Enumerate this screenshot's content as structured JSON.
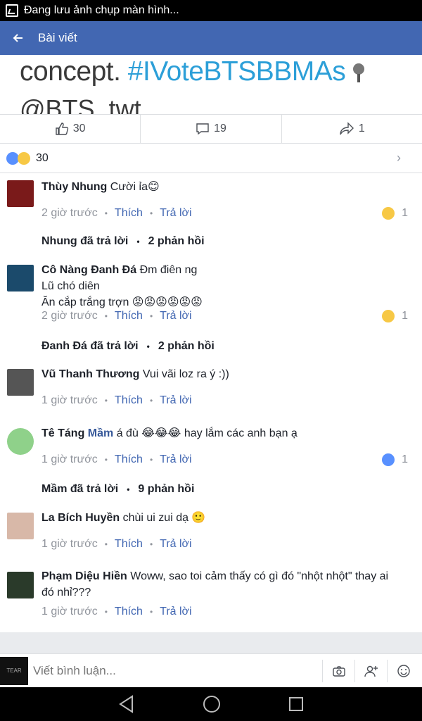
{
  "status_bar": {
    "text": "Đang lưu ảnh chụp màn hình..."
  },
  "app_bar": {
    "title": "Bài viết"
  },
  "post_image": {
    "line1_text": "concept. ",
    "line1_hashtag": "#IVoteBTSBBMAs",
    "line2_text": "@BTS_twt"
  },
  "actions": {
    "likes": "30",
    "comments": "19",
    "shares": "1"
  },
  "reactions_summary": {
    "count": "30"
  },
  "comments": [
    {
      "name": "Thùy Nhung",
      "text": "Cười ỉa😊",
      "time": "2 giờ trước",
      "like": "Thích",
      "reply": "Trả lời",
      "reaction_count": "1",
      "reaction": "laugh"
    },
    {
      "name": "Cô Nàng Đanh Đá",
      "text": "Đm điên ng",
      "text2": "Lũ chó diên",
      "text3": "Ăn cắp trắng trợn 😡😡😡😡😡😡",
      "time": "2 giờ trước",
      "like": "Thích",
      "reply": "Trả lời",
      "reaction_count": "1",
      "reaction": "laugh"
    },
    {
      "name": "Vũ Thanh Thương",
      "text": "Vui vãi loz ra ý :))",
      "time": "1 giờ trước",
      "like": "Thích",
      "reply": "Trả lời"
    },
    {
      "name": "Tê Táng",
      "name_tag": "Mầm",
      "text": "á đù 😂😂😂 hay lắm các anh bạn ạ",
      "time": "1 giờ trước",
      "like": "Thích",
      "reply": "Trả lời",
      "reaction_count": "1",
      "reaction": "like"
    },
    {
      "name": "La Bích Huyền",
      "text": "chùi ui zui dạ 🙂",
      "time": "1 giờ trước",
      "like": "Thích",
      "reply": "Trả lời"
    },
    {
      "name": "Phạm Diệu Hiền",
      "text": "Woww, sao toi cảm thấy có gì đó \"nhột nhột\" thay ai",
      "text2": "đó nhỉ???",
      "time": "1 giờ trước",
      "like": "Thích",
      "reply": "Trả lời"
    }
  ],
  "reply_threads": [
    {
      "who": "Nhung đã trả lời",
      "count": "2 phản hồi"
    },
    {
      "who": "Đanh Đá đã trả lời",
      "count": "2 phản hồi"
    },
    {
      "who": "Mầm đã trả lời",
      "count": "9 phản hồi"
    }
  ],
  "composer": {
    "placeholder": "Viết bình luận...",
    "avatar_text": "TEAR"
  },
  "colors": {
    "brand": "#4267b2",
    "link": "#4267b2",
    "meta": "#90949c"
  }
}
